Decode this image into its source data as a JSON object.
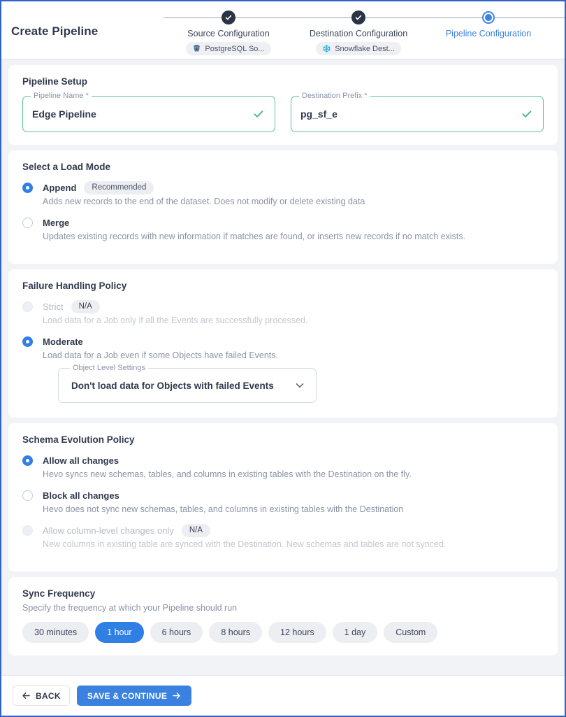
{
  "header": {
    "title": "Create Pipeline",
    "steps": [
      {
        "label": "Source Configuration",
        "state": "done",
        "chip": "PostgreSQL So...",
        "chip_icon": "postgresql-icon"
      },
      {
        "label": "Destination Configuration",
        "state": "done",
        "chip": "Snowflake Dest...",
        "chip_icon": "snowflake-icon"
      },
      {
        "label": "Pipeline Configuration",
        "state": "active",
        "chip": "",
        "chip_icon": ""
      }
    ]
  },
  "pipeline_setup": {
    "title": "Pipeline Setup",
    "pipeline_name": {
      "legend": "Pipeline Name *",
      "value": "Edge Pipeline",
      "valid_icon": "check-icon"
    },
    "destination_prefix": {
      "legend": "Destination Prefix *",
      "value": "pg_sf_e",
      "valid_icon": "check-icon"
    }
  },
  "load_mode": {
    "title": "Select a Load Mode",
    "options": [
      {
        "label": "Append",
        "badge": "Recommended",
        "desc": "Adds new records to the end of the dataset. Does not modify or delete existing data",
        "selected": true,
        "disabled": false
      },
      {
        "label": "Merge",
        "badge": "",
        "desc": "Updates existing records with new information if matches are found, or inserts new records if no match exists.",
        "selected": false,
        "disabled": false
      }
    ]
  },
  "failure_policy": {
    "title": "Failure Handling Policy",
    "options": [
      {
        "label": "Strict",
        "badge": "N/A",
        "desc": "Load data for a Job only if all the Events are successfully processed.",
        "selected": false,
        "disabled": true
      },
      {
        "label": "Moderate",
        "badge": "",
        "desc": "Load data for a Job even if some Objects have failed Events.",
        "selected": true,
        "disabled": false
      }
    ],
    "object_level_settings": {
      "legend": "Object Level Settings",
      "value": "Don't load data for Objects with failed Events",
      "chevron_icon": "chevron-down-icon"
    }
  },
  "schema_policy": {
    "title": "Schema Evolution Policy",
    "options": [
      {
        "label": "Allow all changes",
        "badge": "",
        "desc": "Hevo syncs new schemas, tables, and columns in existing tables with the Destination on the fly.",
        "selected": true,
        "disabled": false
      },
      {
        "label": "Block all changes",
        "badge": "",
        "desc": "Hevo does not sync new schemas, tables, and columns in existing tables with the Destination",
        "selected": false,
        "disabled": false
      },
      {
        "label": "Allow column-level changes only",
        "badge": "N/A",
        "desc": "New columns in existing table are synced with the Destination. New schemas and tables are not synced.",
        "selected": false,
        "disabled": true
      }
    ]
  },
  "sync_frequency": {
    "title": "Sync Frequency",
    "subtitle": "Specify the frequency at which your Pipeline should run",
    "options": [
      {
        "label": "30 minutes",
        "selected": false
      },
      {
        "label": "1 hour",
        "selected": true
      },
      {
        "label": "6 hours",
        "selected": false
      },
      {
        "label": "8 hours",
        "selected": false
      },
      {
        "label": "12 hours",
        "selected": false
      },
      {
        "label": "1 day",
        "selected": false
      },
      {
        "label": "Custom",
        "selected": false
      }
    ]
  },
  "footer": {
    "back_label": "BACK",
    "back_icon": "arrow-left-icon",
    "continue_label": "SAVE & CONTINUE",
    "continue_icon": "arrow-right-icon"
  },
  "colors": {
    "accent": "#3b82e0",
    "valid": "#5cc295",
    "step_done": "#2b3445",
    "page_border": "#2f63c4",
    "bg": "#f1f3f6"
  }
}
